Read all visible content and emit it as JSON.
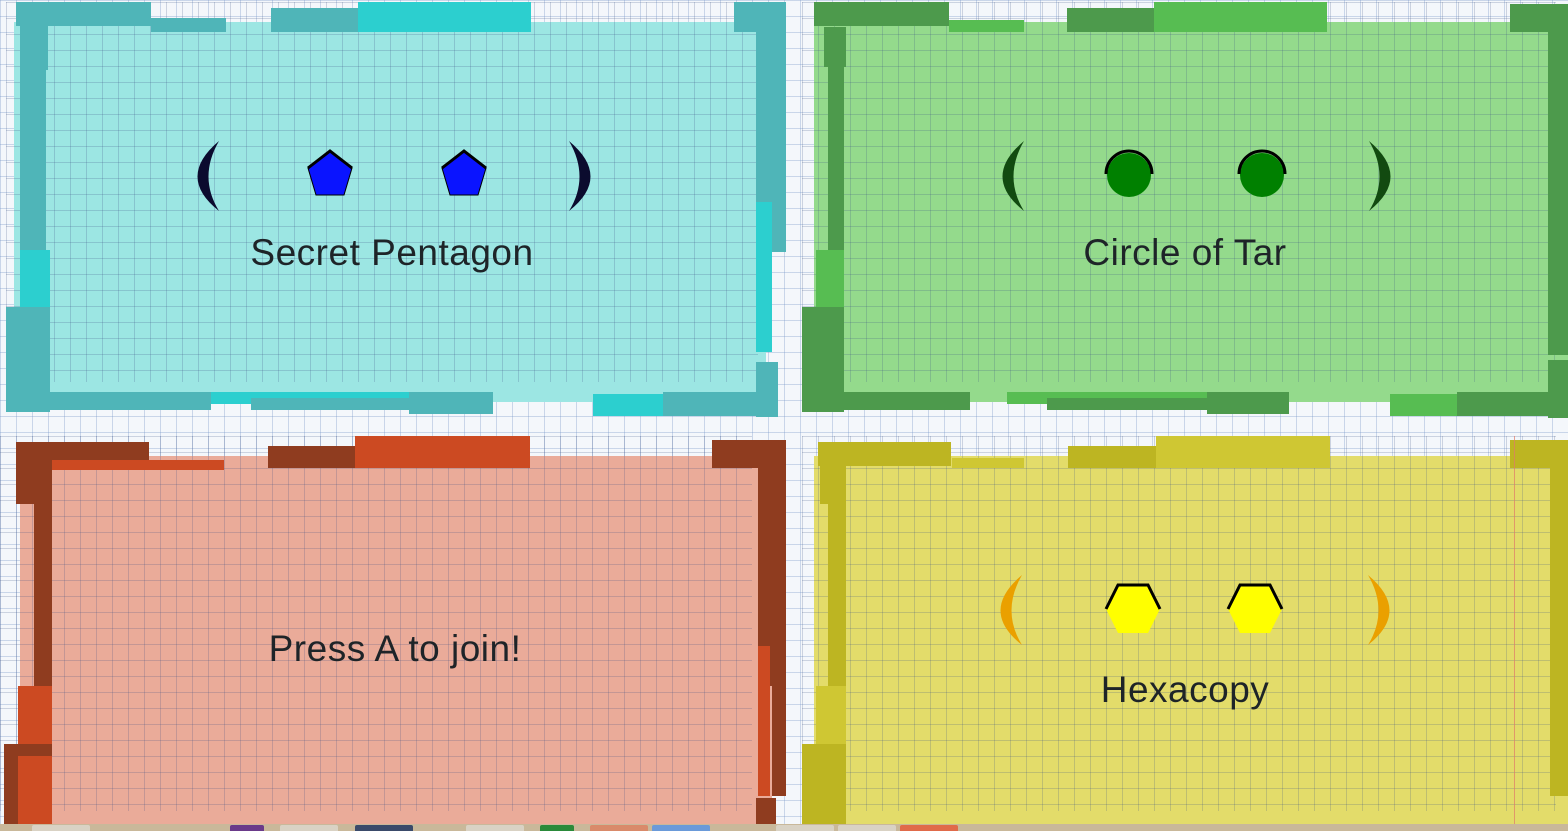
{
  "panels": [
    {
      "id": "blue",
      "label": "Secret Pentagon",
      "colors": {
        "fill": "#9ce6e3",
        "border": "#4fb5b8",
        "accent": "#2ccfcf",
        "shape": "#0a14ff",
        "bracket": "#0b0b2e"
      },
      "shape_icon": "pentagon-icon"
    },
    {
      "id": "green",
      "label": "Circle of Tar",
      "colors": {
        "fill": "#94da8c",
        "border": "#4d9a4c",
        "accent": "#57bd52",
        "shape": "#008000",
        "bracket": "#124a10"
      },
      "shape_icon": "circle-icon"
    },
    {
      "id": "red",
      "label": "Press A to join!",
      "colors": {
        "fill": "#eaab99",
        "border": "#8f3c1f",
        "accent": "#cc4a22"
      }
    },
    {
      "id": "yellow",
      "label": "Hexacopy",
      "colors": {
        "fill": "#e3dc6a",
        "border": "#bdb522",
        "accent": "#cfc733",
        "shape": "#ffff00",
        "bracket": "#eaa000"
      },
      "shape_icon": "hexagon-icon"
    }
  ],
  "taskbar": {
    "color": "#c9b89a"
  }
}
